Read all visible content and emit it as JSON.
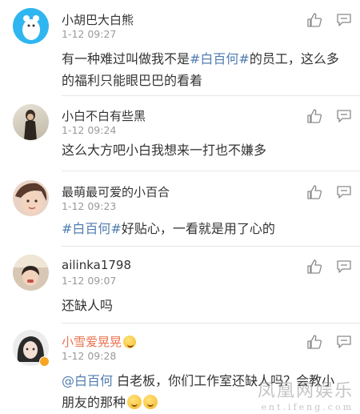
{
  "comments": [
    {
      "author": "小胡巴大白熊",
      "time": "1-12 09:27",
      "text_parts": [
        "有一种难过叫做我不是",
        "#白百何#",
        "的员工，这么多的福利只能眼巴巴的看着"
      ]
    },
    {
      "author": "小白不白有些黑",
      "time": "1-12 09:24",
      "text_parts": [
        "这么大方吧小白我想来一打也不嫌多"
      ]
    },
    {
      "author": "最萌最可爱的小百合",
      "time": "1-12 09:23",
      "text_parts": [
        "#白百何#",
        "好贴心，一看就是用了心的"
      ]
    },
    {
      "author": "ailinka1798",
      "time": "1-12 09:07",
      "text_parts": [
        "还缺人吗"
      ]
    },
    {
      "author": "小雪爱晃晃",
      "time": "1-12 09:28",
      "text_parts": [
        "@白百何",
        " 白老板，你们工作室还缺人吗？会教小朋友的那种"
      ]
    }
  ],
  "icons": {
    "like": "thumbs-up-icon",
    "reply": "reply-icon",
    "emoji": "smile-emoji-icon"
  },
  "colors": {
    "topic": "#507daf",
    "vip_name": "#eb7350",
    "text": "#333333",
    "meta": "#9a9a9a",
    "icon": "#8a8a8a"
  },
  "watermark": {
    "cn": "凤凰网娱乐",
    "en": "ent.ifeng.com"
  }
}
